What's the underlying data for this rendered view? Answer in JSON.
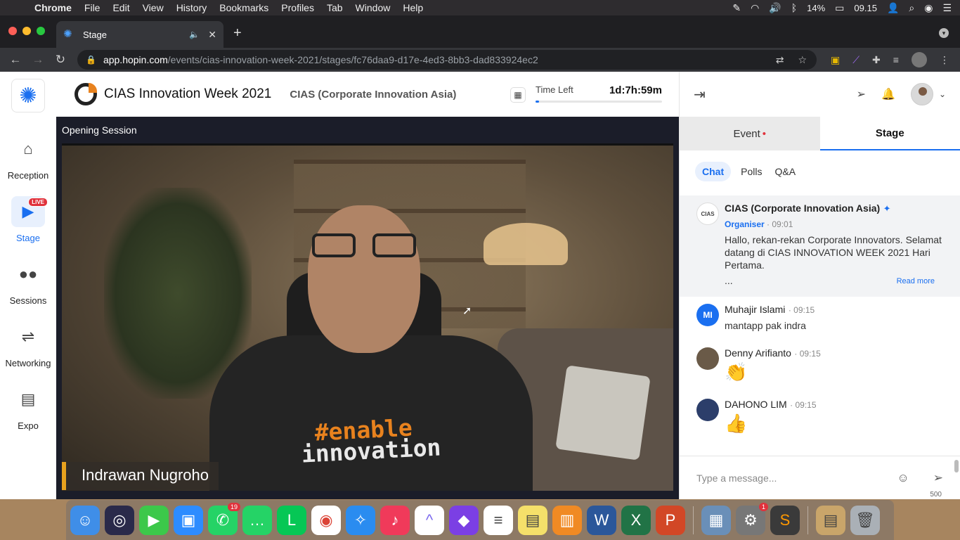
{
  "menubar": {
    "app": "Chrome",
    "items": [
      "File",
      "Edit",
      "View",
      "History",
      "Bookmarks",
      "Profiles",
      "Tab",
      "Window",
      "Help"
    ],
    "battery": "14%",
    "clock": "09.15"
  },
  "browser": {
    "tab_title": "Stage",
    "url_host": "app.hopin.com",
    "url_path": "/events/cias-innovation-week-2021/stages/fc76daa9-d17e-4ed3-8bb3-dad833924ec2"
  },
  "nav": {
    "items": [
      {
        "label": "Reception",
        "icon": "home-icon"
      },
      {
        "label": "Stage",
        "icon": "video-camera-icon",
        "badge": "LIVE"
      },
      {
        "label": "Sessions",
        "icon": "people-icon"
      },
      {
        "label": "Networking",
        "icon": "handshake-icon"
      },
      {
        "label": "Expo",
        "icon": "store-icon"
      }
    ]
  },
  "header": {
    "event_title": "CIAS Innovation Week 2021",
    "organiser": "CIAS (Corporate Innovation Asia)",
    "time_left_label": "Time Left",
    "time_left_value": "1d:7h:59m",
    "time_left_progress": 0.03
  },
  "stage": {
    "session_name": "Opening Session",
    "speaker_name": "Indrawan Nugroho",
    "shirt_text_line1": "#enable",
    "shirt_text_line2": "innovation"
  },
  "panel": {
    "tabs": [
      "Event",
      "Stage"
    ],
    "active_tab": "Stage",
    "subtabs": [
      "Chat",
      "Polls",
      "Q&A"
    ],
    "active_subtab": "Chat",
    "pinned": {
      "avatar_text": "CIAS",
      "name": "CIAS (Corporate Innovation Asia)",
      "role": "Organiser",
      "time": "09:01",
      "text": "Hallo, rekan-rekan Corporate Innovators. Selamat datang di CIAS INNOVATION WEEK 2021 Hari Pertama.",
      "ellipsis": "...",
      "read_more": "Read more"
    },
    "messages": [
      {
        "initials": "MI",
        "name": "Muhajir Islami",
        "time": "09:15",
        "text": "mantapp pak indra"
      },
      {
        "initials": "",
        "name": "Denny Arifianto",
        "time": "09:15",
        "text": "👏"
      },
      {
        "initials": "",
        "name": "DAHONO LIM",
        "time": "09:15",
        "text": "👍"
      }
    ],
    "compose_placeholder": "Type a message...",
    "char_counter": "500"
  },
  "dock": {
    "whatsapp_badge": "19",
    "sysprefs_badge": "1"
  },
  "colors": {
    "accent": "#1a6ff0",
    "live": "#e0323c",
    "stage_bg": "#1b1d29"
  }
}
